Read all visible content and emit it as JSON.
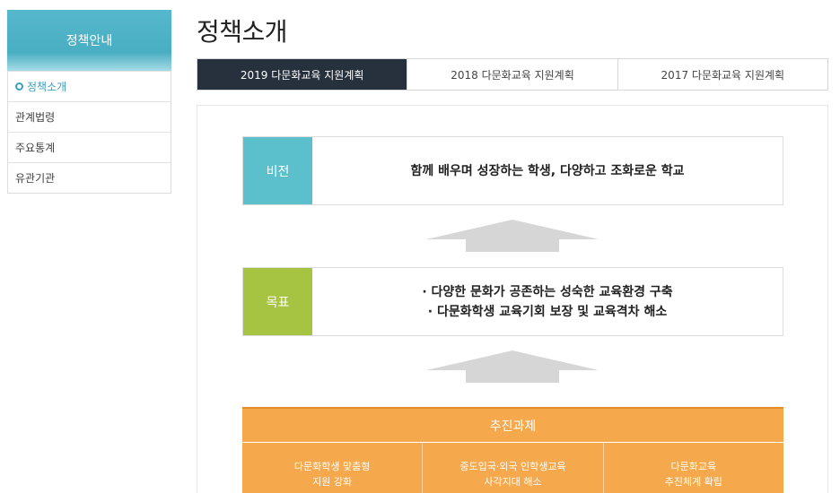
{
  "sidebar": {
    "title": "정책안내",
    "items": [
      {
        "label": "정책소개",
        "active": true
      },
      {
        "label": "관계법령"
      },
      {
        "label": "주요통계"
      },
      {
        "label": "유관기관"
      }
    ]
  },
  "main": {
    "title": "정책소개",
    "tabs": [
      {
        "label": "2019 다문화교육 지원계획",
        "active": true
      },
      {
        "label": "2018 다문화교육 지원계획"
      },
      {
        "label": "2017 다문화교육 지원계획"
      }
    ],
    "vision": {
      "label": "비전",
      "text": "함께 배우며 성장하는 학생, 다양하고 조화로운 학교"
    },
    "goal": {
      "label": "목표",
      "lines": [
        "· 다양한 문화가 공존하는 성숙한 교육환경 구축",
        "· 다문화학생 교육기회 보장 및 교육격차 해소"
      ]
    },
    "tasks": {
      "title": "추진과제",
      "items": [
        {
          "line1": "다문화학생 맞춤형",
          "line2": "지원 강화"
        },
        {
          "line1": "중도입국·외국 인학생교육",
          "line2": "사각지대 해소"
        },
        {
          "line1": "다문화교육",
          "line2": "추진체계 확립"
        }
      ]
    }
  },
  "colors": {
    "vision": "#5bbfcc",
    "goal": "#a6c441",
    "tasks": "#f5a84c",
    "active_tab": "#27313e",
    "sidebar_accent": "#3a9fc1"
  }
}
